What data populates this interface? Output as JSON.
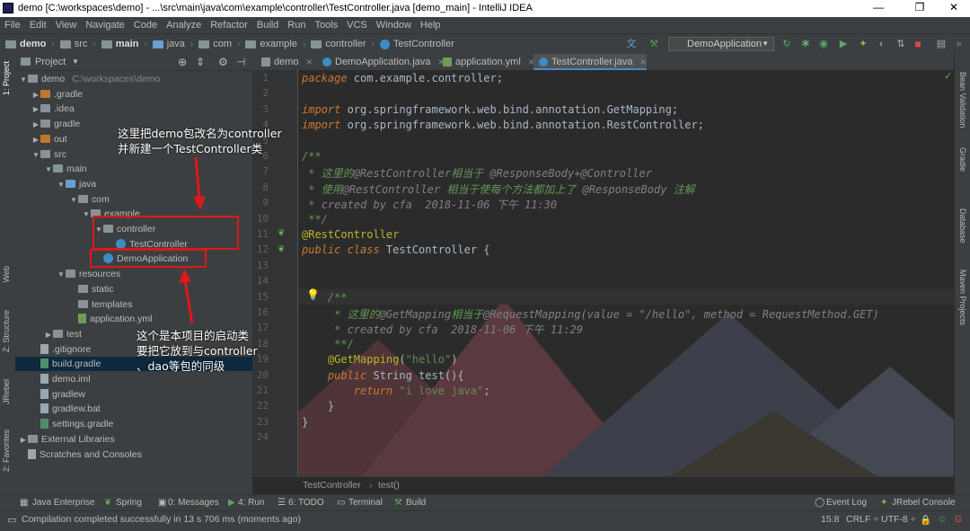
{
  "window": {
    "title": "demo [C:\\workspaces\\demo] - ...\\src\\main\\java\\com\\example\\controller\\TestController.java [demo_main] - IntelliJ IDEA",
    "minimize": "—",
    "maximize": "❐",
    "close": "✕"
  },
  "menu": [
    "File",
    "Edit",
    "View",
    "Navigate",
    "Code",
    "Analyze",
    "Refactor",
    "Build",
    "Run",
    "Tools",
    "VCS",
    "Window",
    "Help"
  ],
  "navbar": {
    "crumbs": [
      "demo",
      "src",
      "main",
      "java",
      "com",
      "example",
      "controller",
      "TestController"
    ],
    "run_config": "DemoApplication"
  },
  "project_panel": {
    "header": "Project",
    "tree": [
      {
        "label": "demo",
        "extra": "C:\\workspaces\\demo",
        "indent": 0,
        "arrow": "▼",
        "icon": "folder"
      },
      {
        "label": ".gradle",
        "indent": 1,
        "arrow": "▶",
        "icon": "folder-orange"
      },
      {
        "label": ".idea",
        "indent": 1,
        "arrow": "▶",
        "icon": "folder"
      },
      {
        "label": "gradle",
        "indent": 1,
        "arrow": "▶",
        "icon": "folder"
      },
      {
        "label": "out",
        "indent": 1,
        "arrow": "▶",
        "icon": "folder-orange"
      },
      {
        "label": "src",
        "indent": 1,
        "arrow": "▼",
        "icon": "folder"
      },
      {
        "label": "main",
        "indent": 2,
        "arrow": "▼",
        "icon": "folder"
      },
      {
        "label": "java",
        "indent": 3,
        "arrow": "▼",
        "icon": "folder-blue"
      },
      {
        "label": "com",
        "indent": 4,
        "arrow": "▼",
        "icon": "folder"
      },
      {
        "label": "example",
        "indent": 5,
        "arrow": "▼",
        "icon": "folder"
      },
      {
        "label": "controller",
        "indent": 6,
        "arrow": "▼",
        "icon": "folder"
      },
      {
        "label": "TestController",
        "indent": 7,
        "arrow": "",
        "icon": "class"
      },
      {
        "label": "DemoApplication",
        "indent": 6,
        "arrow": "",
        "icon": "class"
      },
      {
        "label": "resources",
        "indent": 3,
        "arrow": "▼",
        "icon": "folder-res"
      },
      {
        "label": "static",
        "indent": 4,
        "arrow": "",
        "icon": "folder"
      },
      {
        "label": "templates",
        "indent": 4,
        "arrow": "",
        "icon": "folder"
      },
      {
        "label": "application.yml",
        "indent": 4,
        "arrow": "",
        "icon": "file-yml"
      },
      {
        "label": "test",
        "indent": 2,
        "arrow": "▶",
        "icon": "folder"
      },
      {
        "label": ".gitignore",
        "indent": 1,
        "arrow": "",
        "icon": "file"
      },
      {
        "label": "build.gradle",
        "indent": 1,
        "arrow": "",
        "icon": "file-gradle",
        "selected": true
      },
      {
        "label": "demo.iml",
        "indent": 1,
        "arrow": "",
        "icon": "file"
      },
      {
        "label": "gradlew",
        "indent": 1,
        "arrow": "",
        "icon": "file"
      },
      {
        "label": "gradlew.bat",
        "indent": 1,
        "arrow": "",
        "icon": "file"
      },
      {
        "label": "settings.gradle",
        "indent": 1,
        "arrow": "",
        "icon": "file-gradle"
      },
      {
        "label": "External Libraries",
        "indent": 0,
        "arrow": "▶",
        "icon": "lib"
      },
      {
        "label": "Scratches and Consoles",
        "indent": 0,
        "arrow": "",
        "icon": "scratch"
      }
    ]
  },
  "editor_tabs": [
    {
      "label": "demo",
      "active": false
    },
    {
      "label": "DemoApplication.java",
      "active": false
    },
    {
      "label": "application.yml",
      "active": false
    },
    {
      "label": "TestController.java",
      "active": true
    }
  ],
  "code_lines": [
    {
      "n": "1",
      "html": "<span class='kw'>package</span> com.example.controller;"
    },
    {
      "n": "2",
      "html": ""
    },
    {
      "n": "3",
      "html": "<span class='kw'>import</span> org.springframework.web.bind.annotation.GetMapping;"
    },
    {
      "n": "4",
      "html": "<span class='kw'>import</span> org.springframework.web.bind.annotation.RestController;"
    },
    {
      "n": "5",
      "html": ""
    },
    {
      "n": "6",
      "html": "<span class='cm'>/**</span>"
    },
    {
      "n": "7",
      "html": "<span class='cm'> * 这里的</span><span class='cmg'>@RestController</span><span class='cm'>相当于 </span><span class='cmg'>@ResponseBody+@Controller</span>"
    },
    {
      "n": "8",
      "html": "<span class='cm'> * 使用</span><span class='cmg'>@RestController</span><span class='cm'> 相当于使每个方法都加上了 </span><span class='cmg'>@ResponseBody</span><span class='cm'> 注解</span>"
    },
    {
      "n": "9",
      "html": "<span class='cm'> * </span><span class='cmg'>created by cfa  2018-11-06 下午 11:30</span>"
    },
    {
      "n": "10",
      "html": "<span class='cm'> **/</span>"
    },
    {
      "n": "11",
      "html": "<span class='ann'>@RestController</span>"
    },
    {
      "n": "12",
      "html": "<span class='kw'>public class</span> TestController {"
    },
    {
      "n": "13",
      "html": ""
    },
    {
      "n": "14",
      "html": ""
    },
    {
      "n": "15",
      "html": "    <span class='cm'>/**</span>"
    },
    {
      "n": "16",
      "html": "<span class='cm'>     * 这里的</span><span class='cmg'>@GetMapping</span><span class='cm'>相当于</span><span class='cmg'>@RequestMapping(value = \"/hello\", method = RequestMethod.GET)</span>"
    },
    {
      "n": "17",
      "html": "<span class='cm'>     * </span><span class='cmg'>created by cfa  2018-11-06 下午 11:29</span>"
    },
    {
      "n": "18",
      "html": "<span class='cm'>     **/</span>"
    },
    {
      "n": "19",
      "html": "    <span class='ann'>@GetMapping</span>(<span class='str'>\"hello\"</span>)"
    },
    {
      "n": "20",
      "html": "    <span class='kw'>public</span> String test(){"
    },
    {
      "n": "21",
      "html": "        <span class='kw'>return</span> <span class='str'>\"i love java\"</span>;"
    },
    {
      "n": "22",
      "html": "    }"
    },
    {
      "n": "23",
      "html": "}"
    },
    {
      "n": "24",
      "html": ""
    }
  ],
  "editor_breadcrumb": [
    "TestController",
    "test()"
  ],
  "bottom_tools": [
    "Java Enterprise",
    "Spring",
    "0: Messages",
    "4: Run",
    "6: TODO",
    "Terminal",
    "Build",
    "Event Log",
    "JRebel Console"
  ],
  "status": {
    "message": "Compilation completed successfully in 13 s 706 ms (moments ago)",
    "position": "15:8",
    "line_sep": "CRLF ÷",
    "encoding": "UTF-8 ÷"
  },
  "left_strip": [
    "1: Project",
    "Web",
    "Z: Structure",
    "JRebel",
    "2: Favorites"
  ],
  "right_strip": [
    "Bean Validation",
    "Gradle",
    "Database",
    "Maven Projects"
  ],
  "annotations": {
    "note1": [
      "这里把demo包改名为controller",
      "并新建一个TestController类"
    ],
    "note2": [
      "这个是本项目的启动类",
      "要把它放到与controller",
      "、dao等包的同级"
    ]
  },
  "colors": {
    "accent": "#4a88c7",
    "annotation_red": "#e01818"
  }
}
